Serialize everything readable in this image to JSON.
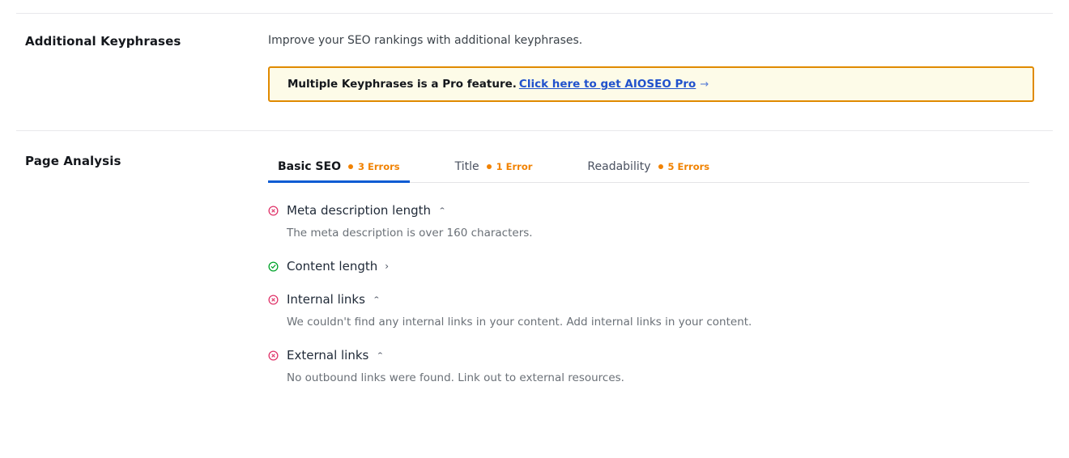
{
  "sections": {
    "keyphrases": {
      "label": "Additional Keyphrases",
      "intro": "Improve your SEO rankings with additional keyphrases.",
      "notice": {
        "text": "Multiple Keyphrases is a Pro feature.",
        "link_label": "Click here to get AIOSEO Pro",
        "arrow": "→",
        "background": "#fdfbe8",
        "border_color": "#e08a00",
        "link_color": "#2152cc"
      }
    },
    "analysis": {
      "label": "Page Analysis",
      "tabs": [
        {
          "label": "Basic SEO",
          "errors": "3 Errors",
          "active": true
        },
        {
          "label": "Title",
          "errors": "1 Error",
          "active": false
        },
        {
          "label": "Readability",
          "errors": "5 Errors",
          "active": false
        }
      ],
      "accent_color": "#0b5bd3",
      "error_color": "#f18200",
      "items": [
        {
          "title": "Meta description length",
          "status": "error",
          "chevron": "⌃",
          "expanded": true,
          "description": "The meta description is over 160 characters."
        },
        {
          "title": "Content length",
          "status": "pass",
          "chevron": "›",
          "expanded": false,
          "description": ""
        },
        {
          "title": "Internal links",
          "status": "error",
          "chevron": "⌃",
          "expanded": true,
          "description": "We couldn't find any internal links in your content. Add internal links in your content."
        },
        {
          "title": "External links",
          "status": "error",
          "chevron": "⌃",
          "expanded": true,
          "description": "No outbound links were found. Link out to external resources."
        }
      ],
      "status_colors": {
        "error": "#e0366b",
        "pass": "#00a32a"
      }
    }
  }
}
